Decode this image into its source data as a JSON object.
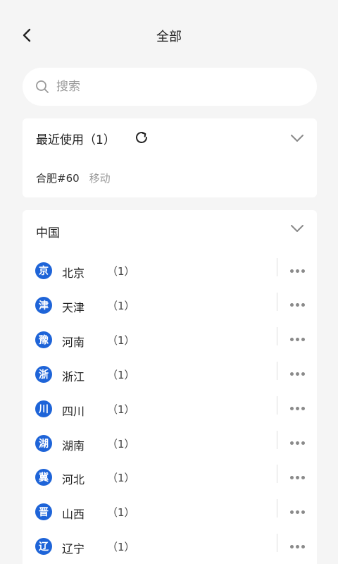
{
  "header": {
    "title": "全部"
  },
  "search": {
    "placeholder": "搜索"
  },
  "recent": {
    "title": "最近使用（1）",
    "items": [
      {
        "name": "合肥#60",
        "carrier": "移动"
      }
    ]
  },
  "region": {
    "title": "中国",
    "provinces": [
      {
        "badge": "京",
        "name": "北京",
        "count": "（1）"
      },
      {
        "badge": "津",
        "name": "天津",
        "count": "（1）"
      },
      {
        "badge": "豫",
        "name": "河南",
        "count": "（1）"
      },
      {
        "badge": "浙",
        "name": "浙江",
        "count": "（1）"
      },
      {
        "badge": "川",
        "name": "四川",
        "count": "（1）"
      },
      {
        "badge": "湖",
        "name": "湖南",
        "count": "（1）"
      },
      {
        "badge": "冀",
        "name": "河北",
        "count": "（1）"
      },
      {
        "badge": "晋",
        "name": "山西",
        "count": "（1）"
      },
      {
        "badge": "辽",
        "name": "辽宁",
        "count": "（1）"
      }
    ]
  },
  "colors": {
    "accent": "#1e64d8",
    "background": "#f5f5f5",
    "card": "#ffffff"
  }
}
